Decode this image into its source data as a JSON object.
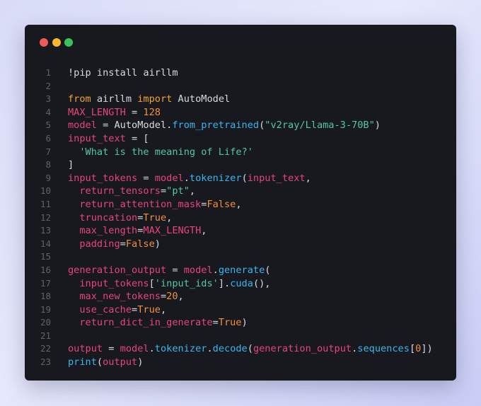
{
  "window": {
    "controls": [
      {
        "name": "close",
        "color": "#ef5b5b"
      },
      {
        "name": "minimize",
        "color": "#f5b72b"
      },
      {
        "name": "maximize",
        "color": "#3cc25a"
      }
    ]
  },
  "code": {
    "lines": [
      {
        "num": "1",
        "tokens": [
          {
            "t": "!pip install airllm",
            "k": "plain"
          }
        ]
      },
      {
        "num": "2",
        "tokens": []
      },
      {
        "num": "3",
        "tokens": [
          {
            "t": "from",
            "k": "kw"
          },
          {
            "t": " airllm ",
            "k": "plain"
          },
          {
            "t": "import",
            "k": "kw"
          },
          {
            "t": " AutoModel",
            "k": "plain"
          }
        ]
      },
      {
        "num": "4",
        "tokens": [
          {
            "t": "MAX_LENGTH",
            "k": "var"
          },
          {
            "t": " = ",
            "k": "plain"
          },
          {
            "t": "128",
            "k": "num"
          }
        ]
      },
      {
        "num": "5",
        "tokens": [
          {
            "t": "model",
            "k": "var"
          },
          {
            "t": " = AutoModel.",
            "k": "plain"
          },
          {
            "t": "from_pretrained",
            "k": "fn"
          },
          {
            "t": "(",
            "k": "plain"
          },
          {
            "t": "\"v2ray/Llama-3-70B\"",
            "k": "str"
          },
          {
            "t": ")",
            "k": "plain"
          }
        ]
      },
      {
        "num": "6",
        "tokens": [
          {
            "t": "input_text",
            "k": "var"
          },
          {
            "t": " = [",
            "k": "plain"
          }
        ]
      },
      {
        "num": "7",
        "tokens": [
          {
            "t": "  ",
            "k": "plain"
          },
          {
            "t": "'What is the meaning of Life?'",
            "k": "str"
          }
        ]
      },
      {
        "num": "8",
        "tokens": [
          {
            "t": "]",
            "k": "plain"
          }
        ]
      },
      {
        "num": "9",
        "tokens": [
          {
            "t": "input_tokens",
            "k": "var"
          },
          {
            "t": " = ",
            "k": "plain"
          },
          {
            "t": "model",
            "k": "var"
          },
          {
            "t": ".",
            "k": "plain"
          },
          {
            "t": "tokenizer",
            "k": "fn"
          },
          {
            "t": "(",
            "k": "plain"
          },
          {
            "t": "input_text",
            "k": "var"
          },
          {
            "t": ",",
            "k": "plain"
          }
        ]
      },
      {
        "num": "10",
        "tokens": [
          {
            "t": "  ",
            "k": "plain"
          },
          {
            "t": "return_tensors",
            "k": "var"
          },
          {
            "t": "=",
            "k": "plain"
          },
          {
            "t": "\"pt\"",
            "k": "str"
          },
          {
            "t": ",",
            "k": "plain"
          }
        ]
      },
      {
        "num": "11",
        "tokens": [
          {
            "t": "  ",
            "k": "plain"
          },
          {
            "t": "return_attention_mask",
            "k": "var"
          },
          {
            "t": "=",
            "k": "plain"
          },
          {
            "t": "False",
            "k": "bool"
          },
          {
            "t": ",",
            "k": "plain"
          }
        ]
      },
      {
        "num": "12",
        "tokens": [
          {
            "t": "  ",
            "k": "plain"
          },
          {
            "t": "truncation",
            "k": "var"
          },
          {
            "t": "=",
            "k": "plain"
          },
          {
            "t": "True",
            "k": "bool"
          },
          {
            "t": ",",
            "k": "plain"
          }
        ]
      },
      {
        "num": "13",
        "tokens": [
          {
            "t": "  ",
            "k": "plain"
          },
          {
            "t": "max_length",
            "k": "var"
          },
          {
            "t": "=",
            "k": "plain"
          },
          {
            "t": "MAX_LENGTH",
            "k": "var"
          },
          {
            "t": ",",
            "k": "plain"
          }
        ]
      },
      {
        "num": "14",
        "tokens": [
          {
            "t": "  ",
            "k": "plain"
          },
          {
            "t": "padding",
            "k": "var"
          },
          {
            "t": "=",
            "k": "plain"
          },
          {
            "t": "False",
            "k": "bool"
          },
          {
            "t": ")",
            "k": "plain"
          }
        ]
      },
      {
        "num": "15",
        "tokens": []
      },
      {
        "num": "16",
        "tokens": [
          {
            "t": "generation_output",
            "k": "var"
          },
          {
            "t": " = ",
            "k": "plain"
          },
          {
            "t": "model",
            "k": "var"
          },
          {
            "t": ".",
            "k": "plain"
          },
          {
            "t": "generate",
            "k": "fn"
          },
          {
            "t": "(",
            "k": "plain"
          }
        ]
      },
      {
        "num": "17",
        "tokens": [
          {
            "t": "  ",
            "k": "plain"
          },
          {
            "t": "input_tokens",
            "k": "var"
          },
          {
            "t": "[",
            "k": "plain"
          },
          {
            "t": "'input_ids'",
            "k": "str"
          },
          {
            "t": "].",
            "k": "plain"
          },
          {
            "t": "cuda",
            "k": "fn"
          },
          {
            "t": "(),",
            "k": "plain"
          }
        ]
      },
      {
        "num": "18",
        "tokens": [
          {
            "t": "  ",
            "k": "plain"
          },
          {
            "t": "max_new_tokens",
            "k": "var"
          },
          {
            "t": "=",
            "k": "plain"
          },
          {
            "t": "20",
            "k": "num"
          },
          {
            "t": ",",
            "k": "plain"
          }
        ]
      },
      {
        "num": "19",
        "tokens": [
          {
            "t": "  ",
            "k": "plain"
          },
          {
            "t": "use_cache",
            "k": "var"
          },
          {
            "t": "=",
            "k": "plain"
          },
          {
            "t": "True",
            "k": "bool"
          },
          {
            "t": ",",
            "k": "plain"
          }
        ]
      },
      {
        "num": "20",
        "tokens": [
          {
            "t": "  ",
            "k": "plain"
          },
          {
            "t": "return_dict_in_generate",
            "k": "var"
          },
          {
            "t": "=",
            "k": "plain"
          },
          {
            "t": "True",
            "k": "bool"
          },
          {
            "t": ")",
            "k": "plain"
          }
        ]
      },
      {
        "num": "21",
        "tokens": []
      },
      {
        "num": "22",
        "tokens": [
          {
            "t": "output",
            "k": "var"
          },
          {
            "t": " = ",
            "k": "plain"
          },
          {
            "t": "model",
            "k": "var"
          },
          {
            "t": ".",
            "k": "plain"
          },
          {
            "t": "tokenizer",
            "k": "fn"
          },
          {
            "t": ".",
            "k": "plain"
          },
          {
            "t": "decode",
            "k": "fn"
          },
          {
            "t": "(",
            "k": "plain"
          },
          {
            "t": "generation_output",
            "k": "var"
          },
          {
            "t": ".",
            "k": "plain"
          },
          {
            "t": "sequences",
            "k": "fn"
          },
          {
            "t": "[",
            "k": "plain"
          },
          {
            "t": "0",
            "k": "num"
          },
          {
            "t": "])",
            "k": "plain"
          }
        ]
      },
      {
        "num": "23",
        "tokens": [
          {
            "t": "print",
            "k": "fn"
          },
          {
            "t": "(",
            "k": "plain"
          },
          {
            "t": "output",
            "k": "var"
          },
          {
            "t": ")",
            "k": "plain"
          }
        ]
      }
    ]
  }
}
